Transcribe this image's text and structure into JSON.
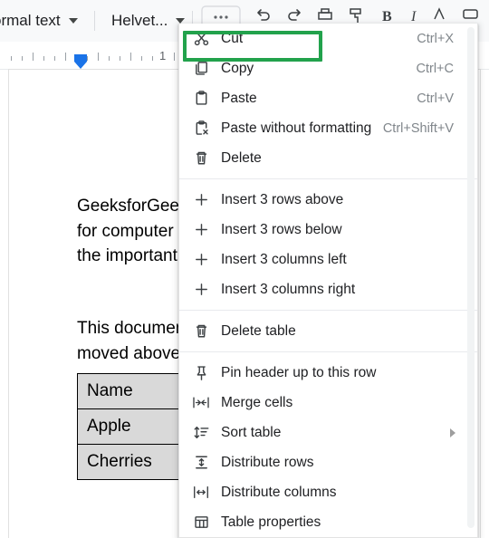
{
  "toolbar": {
    "style_selector": "ormal text",
    "font_selector": "Helvet...",
    "icons": [
      "zoom-control",
      "undo-icon",
      "redo-icon",
      "print-icon",
      "paint-format-icon",
      "bold-icon",
      "italic-icon",
      "underline-icon",
      "text-color-icon",
      "highlight-color-icon",
      "insert-link-icon",
      "insert-comment-icon",
      "insert-image-icon"
    ]
  },
  "ruler": {
    "number_label": "1",
    "indent_marker": "left-indent-marker"
  },
  "document": {
    "paragraphs": [
      "GeeksforGee",
      "for computer",
      "the important",
      "This documen",
      "moved above"
    ],
    "table": {
      "rows": [
        [
          "Name"
        ],
        [
          "Apple"
        ],
        [
          "Cherries"
        ]
      ]
    }
  },
  "context_menu": {
    "highlighted_item": "Cut",
    "highlight_color": "#22a24c",
    "items": [
      {
        "label": "Cut",
        "accel": "Ctrl+X",
        "icon": "scissors-icon",
        "type": "item"
      },
      {
        "label": "Copy",
        "accel": "Ctrl+C",
        "icon": "copy-icon",
        "type": "item"
      },
      {
        "label": "Paste",
        "accel": "Ctrl+V",
        "icon": "clipboard-icon",
        "type": "item"
      },
      {
        "label": "Paste without formatting",
        "accel": "Ctrl+Shift+V",
        "icon": "clipboard-no-format-icon",
        "type": "item"
      },
      {
        "label": "Delete",
        "accel": "",
        "icon": "trash-icon",
        "type": "item"
      },
      {
        "type": "separator"
      },
      {
        "label": "Insert 3 rows above",
        "accel": "",
        "icon": "plus-icon",
        "type": "item"
      },
      {
        "label": "Insert 3 rows below",
        "accel": "",
        "icon": "plus-icon",
        "type": "item"
      },
      {
        "label": "Insert 3 columns left",
        "accel": "",
        "icon": "plus-icon",
        "type": "item"
      },
      {
        "label": "Insert 3 columns right",
        "accel": "",
        "icon": "plus-icon",
        "type": "item"
      },
      {
        "type": "separator"
      },
      {
        "label": "Delete table",
        "accel": "",
        "icon": "trash-icon",
        "type": "item"
      },
      {
        "type": "separator"
      },
      {
        "label": "Pin header up to this row",
        "accel": "",
        "icon": "pin-icon",
        "type": "item"
      },
      {
        "label": "Merge cells",
        "accel": "",
        "icon": "merge-cells-icon",
        "type": "item"
      },
      {
        "label": "Sort table",
        "accel": "",
        "icon": "sort-icon",
        "type": "item",
        "submenu": true
      },
      {
        "label": "Distribute rows",
        "accel": "",
        "icon": "distribute-rows-icon",
        "type": "item"
      },
      {
        "label": "Distribute columns",
        "accel": "",
        "icon": "distribute-columns-icon",
        "type": "item"
      },
      {
        "label": "Table properties",
        "accel": "",
        "icon": "table-properties-icon",
        "type": "item"
      }
    ]
  }
}
